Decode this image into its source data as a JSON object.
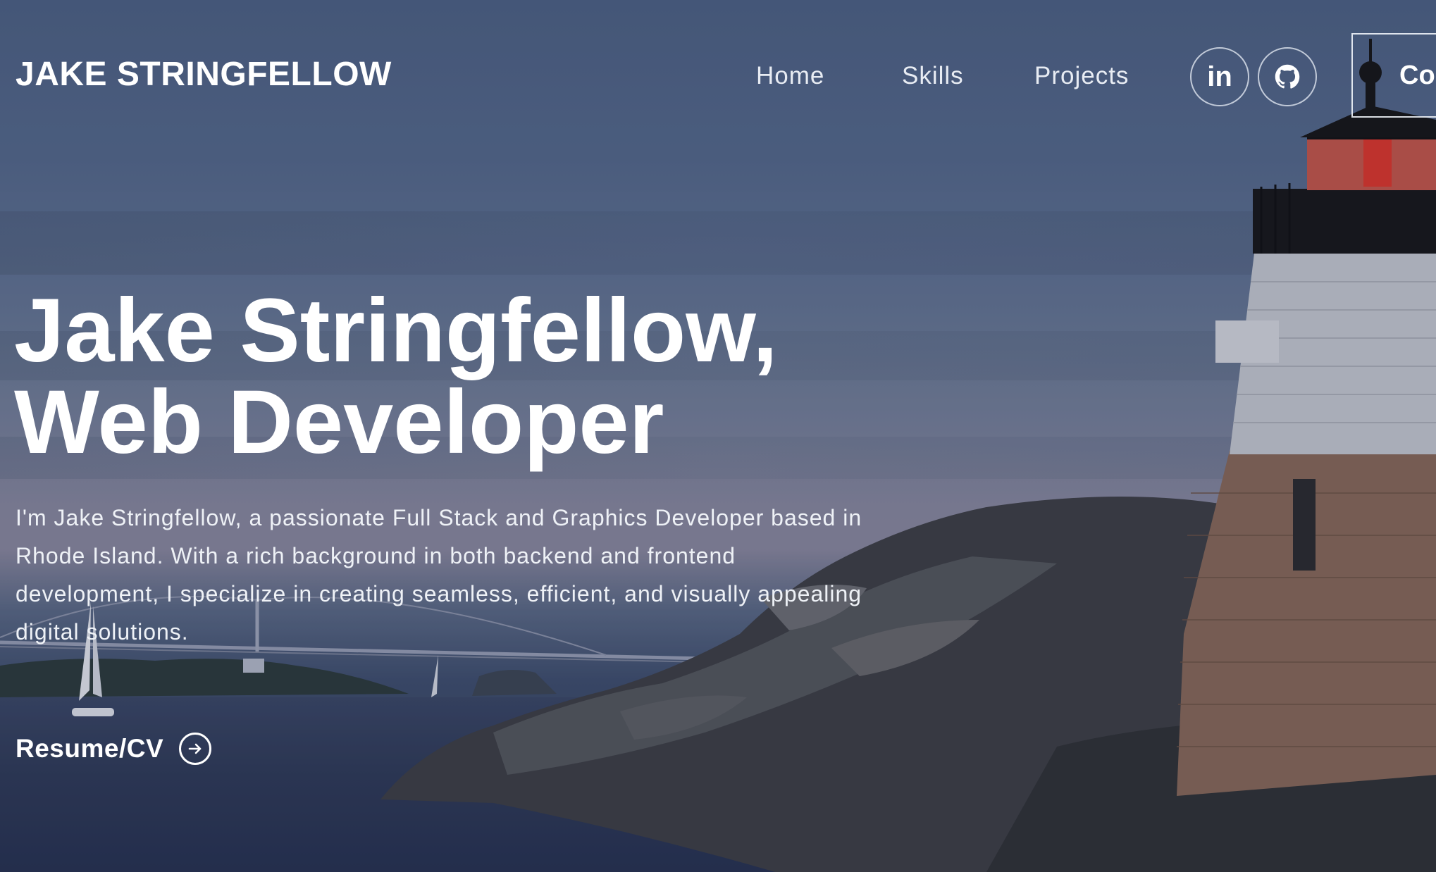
{
  "header": {
    "brand": "JAKE STRINGFELLOW",
    "nav": [
      {
        "label": "Home"
      },
      {
        "label": "Skills"
      },
      {
        "label": "Projects"
      }
    ],
    "social": [
      {
        "icon": "linkedin-icon",
        "label": "in"
      },
      {
        "icon": "github-icon"
      }
    ],
    "contact_label": "Contact"
  },
  "hero": {
    "title_line1": "Jake Stringfellow,",
    "title_line2": "Web Developer",
    "description": "I'm Jake Stringfellow, a passionate Full Stack and Graphics Developer based in Rhode Island. With a rich background in both backend and frontend development, I specialize in creating seamless, efficient, and visually appealing digital solutions.",
    "resume_label": "Resume/CV",
    "resume_icon": "arrow-right-circle-icon"
  },
  "colors": {
    "text": "#ffffff",
    "nav_text": "#e8ecf3",
    "sky_top": "#4e6285",
    "lighthouse_lamp": "#d8463a"
  }
}
